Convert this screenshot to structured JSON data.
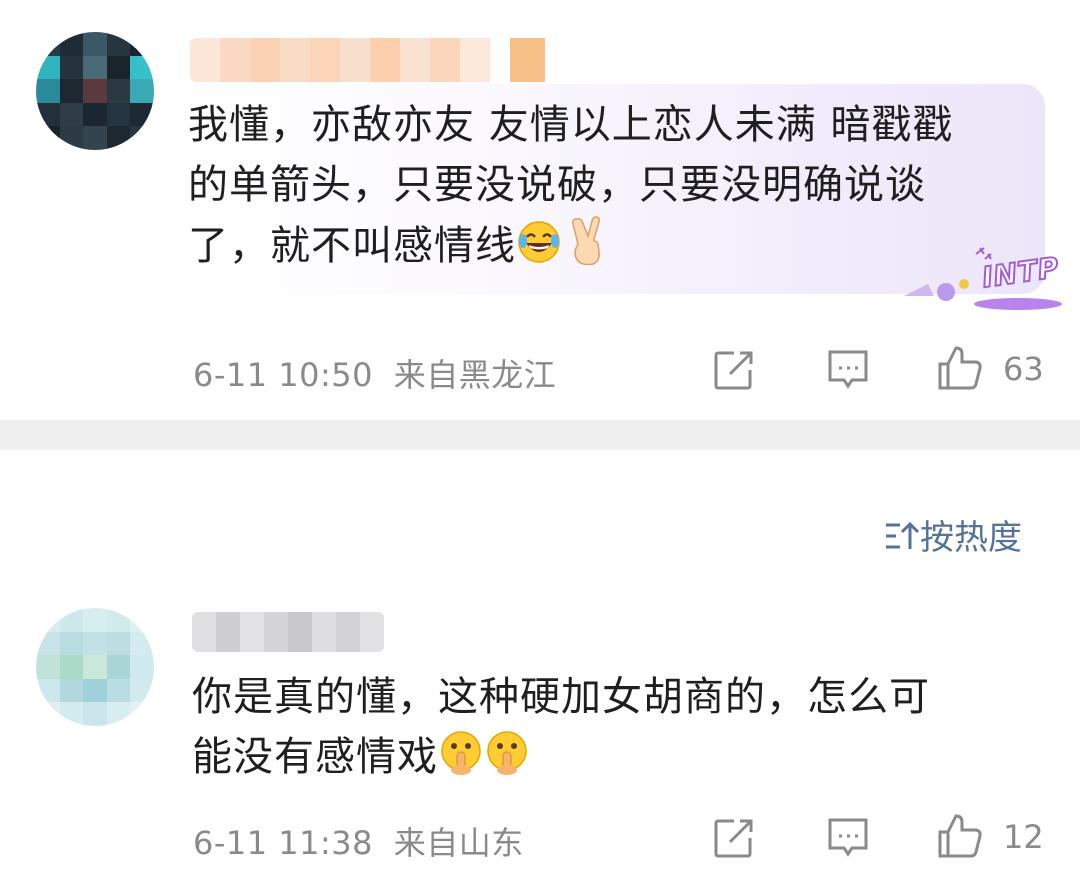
{
  "comments": [
    {
      "text": "我懂，亦敌亦友 友情以上恋人未满 暗戳戳的单箭头，只要没说破，只要没明确说谈了，就不叫感情线",
      "line1": "我懂，亦敌亦友 友情以上恋人未满 暗戳戳",
      "line2": "的单箭头，只要没说破，只要没明确说谈",
      "line3": "了，就不叫感情线",
      "emojis": [
        "laugh-cry-emoji",
        "victory-hand-emoji"
      ],
      "badge": "INTP",
      "time": "6-11 10:50",
      "location": "来自黑龙江",
      "likes": "63"
    },
    {
      "text": "你是真的懂，这种硬加女胡商的，怎么可能没有感情戏",
      "line1": "你是真的懂，这种硬加女胡商的，怎么可",
      "line2": "能没有感情戏",
      "emojis": [
        "shushing-face-emoji",
        "shushing-face-emoji"
      ],
      "time": "6-11 11:38",
      "location": "来自山东",
      "likes": "12"
    }
  ],
  "sort": {
    "icon": "sort-icon",
    "label": "按热度"
  },
  "colors": {
    "meta": "#8a8a8a",
    "link": "#53739b",
    "divider": "#efefef",
    "badge": "#a55bd6"
  },
  "icons": [
    "share-icon",
    "reply-icon",
    "like-icon"
  ]
}
